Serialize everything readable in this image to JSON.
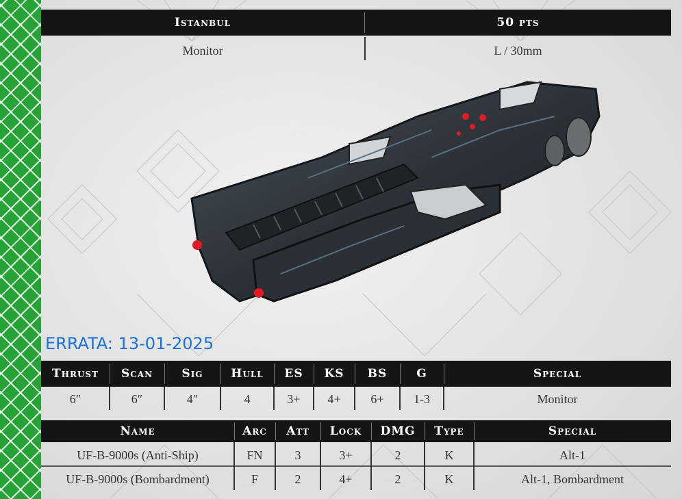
{
  "header": {
    "name": "Istanbul",
    "points": "50 pts",
    "class": "Monitor",
    "size": "L / 30mm"
  },
  "errata": "ERRATA: 13-01-2025",
  "stats": {
    "headers": [
      "Thrust",
      "Scan",
      "Sig",
      "Hull",
      "ES",
      "KS",
      "BS",
      "G",
      "Special"
    ],
    "values": [
      "6″",
      "6″",
      "4″",
      "4",
      "3+",
      "4+",
      "6+",
      "1-3",
      "Monitor"
    ]
  },
  "weapons": {
    "headers": [
      "Name",
      "Arc",
      "Att",
      "Lock",
      "DMG",
      "Type",
      "Special"
    ],
    "rows": [
      [
        "UF-B-9000s (Anti-Ship)",
        "FN",
        "3",
        "3+",
        "2",
        "K",
        "Alt-1"
      ],
      [
        "UF-B-9000s (Bombardment)",
        "F",
        "2",
        "4+",
        "2",
        "K",
        "Alt-1, Bombardment"
      ]
    ]
  },
  "colors": {
    "accent_green": "#27a236",
    "header_bar": "#151515",
    "errata_blue": "#1a73d9"
  },
  "ship_image": "dreadnought-ship-model"
}
